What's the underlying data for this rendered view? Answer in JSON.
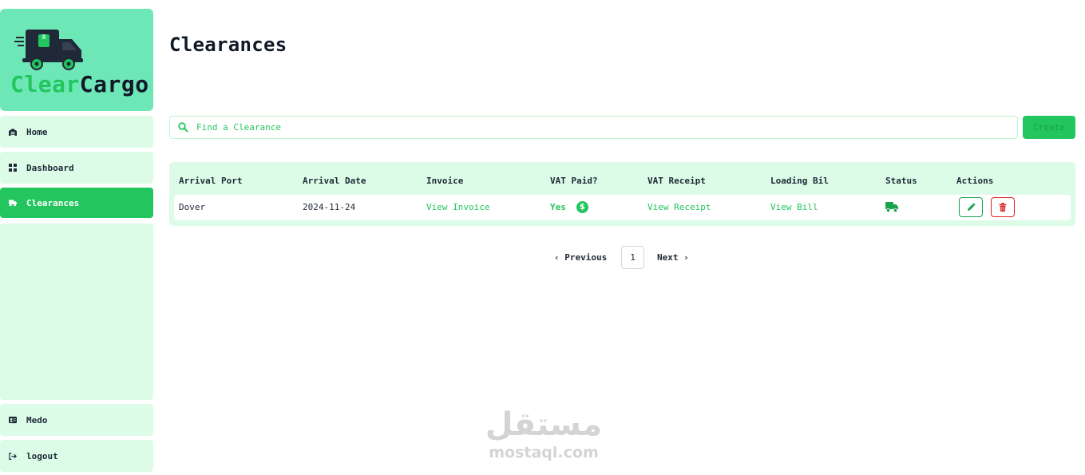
{
  "brand": {
    "part1": "Clear",
    "part2": "Cargo",
    "accent": "#22c55e",
    "logo_bg": "#6ee7b7"
  },
  "sidebar": {
    "items": [
      {
        "label": "Home",
        "icon": "warehouse-icon"
      },
      {
        "label": "Dashboard",
        "icon": "grid-icon"
      },
      {
        "label": "Clearances",
        "icon": "truck-icon",
        "active": true
      }
    ],
    "user": {
      "label": "Medo",
      "icon": "id-card-icon"
    },
    "logout": {
      "label": "logout",
      "icon": "logout-icon"
    }
  },
  "page": {
    "title": "Clearances"
  },
  "search": {
    "placeholder": "Find a Clearance",
    "icon": "search-icon"
  },
  "create_label": "Create",
  "table": {
    "headers": [
      "Arrival Port",
      "Arrival Date",
      "Invoice",
      "VAT Paid?",
      "VAT Receipt",
      "Loading Bil",
      "Status",
      "Actions"
    ],
    "rows": [
      {
        "port": "Dover",
        "date": "2024-11-24",
        "invoice": "View Invoice",
        "vat_paid": "Yes",
        "vat_icon": "$",
        "receipt": "View Receipt",
        "bill": "View Bill",
        "status_icon": "truck-icon"
      }
    ]
  },
  "pagination": {
    "prev": "Previous",
    "current": "1",
    "next": "Next"
  },
  "watermark": {
    "arabic": "مستقل",
    "latin": "mostaql.com"
  }
}
